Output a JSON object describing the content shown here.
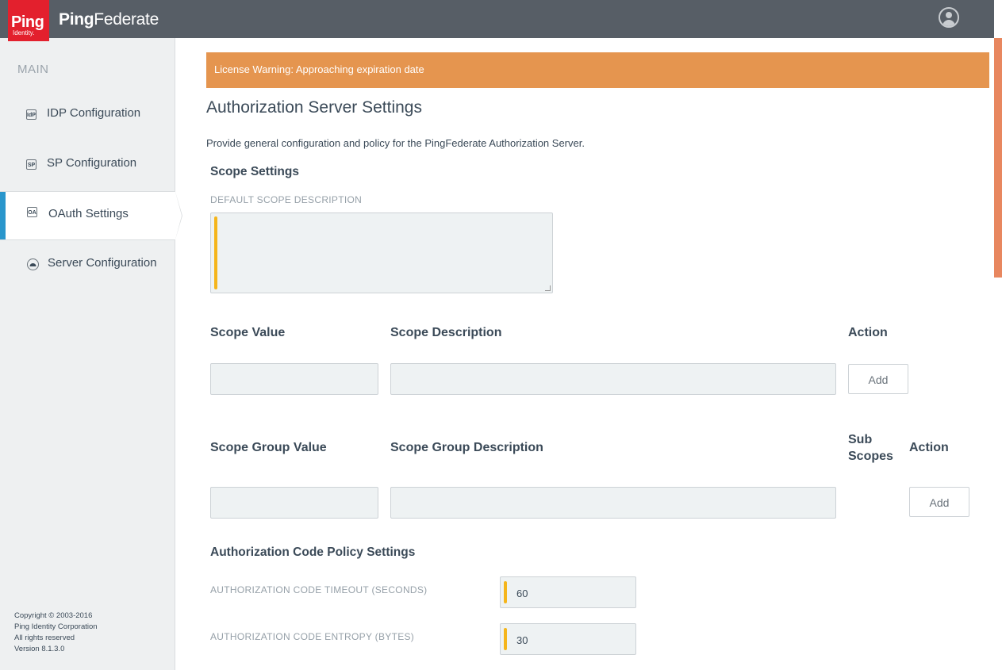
{
  "header": {
    "logo_main": "Ping",
    "logo_sub": "Identity.",
    "brand_bold": "Ping",
    "brand_rest": "Federate"
  },
  "sidebar": {
    "heading": "MAIN",
    "items": [
      {
        "label": "IDP Configuration",
        "icon_text": "IdP",
        "active": false
      },
      {
        "label": "SP Configuration",
        "icon_text": "SP",
        "active": false
      },
      {
        "label": "OAuth Settings",
        "icon_text": "OA",
        "active": true
      },
      {
        "label": "Server Configuration",
        "icon_text": "",
        "active": false
      }
    ],
    "footer": {
      "line1": "Copyright © 2003-2016",
      "line2": "Ping Identity Corporation",
      "line3": "All rights reserved",
      "line4": "Version 8.1.3.0"
    }
  },
  "main": {
    "warning": "License Warning: Approaching expiration date",
    "title": "Authorization Server Settings",
    "description": "Provide general configuration and policy for the PingFederate Authorization Server.",
    "scope_settings": {
      "heading": "Scope Settings",
      "default_desc_label": "DEFAULT SCOPE DESCRIPTION",
      "default_desc_value": "",
      "scope_table": {
        "col_value": "Scope Value",
        "col_description": "Scope Description",
        "col_action": "Action",
        "add_label": "Add"
      },
      "group_table": {
        "col_value": "Scope Group Value",
        "col_description": "Scope Group Description",
        "col_subscopes_1": "Sub",
        "col_subscopes_2": "Scopes",
        "col_action": "Action",
        "add_label": "Add"
      }
    },
    "auth_code": {
      "heading": "Authorization Code Policy Settings",
      "timeout_label": "AUTHORIZATION CODE TIMEOUT (SECONDS)",
      "timeout_value": "60",
      "entropy_label": "AUTHORIZATION CODE ENTROPY (BYTES)",
      "entropy_value": "30"
    }
  },
  "colors": {
    "topbar": "#575e66",
    "logo": "#e3202d",
    "warning": "#e5954f",
    "active_accent": "#2996cc",
    "required_marker": "#f5b51b",
    "scroll_thumb": "#e8875f"
  }
}
